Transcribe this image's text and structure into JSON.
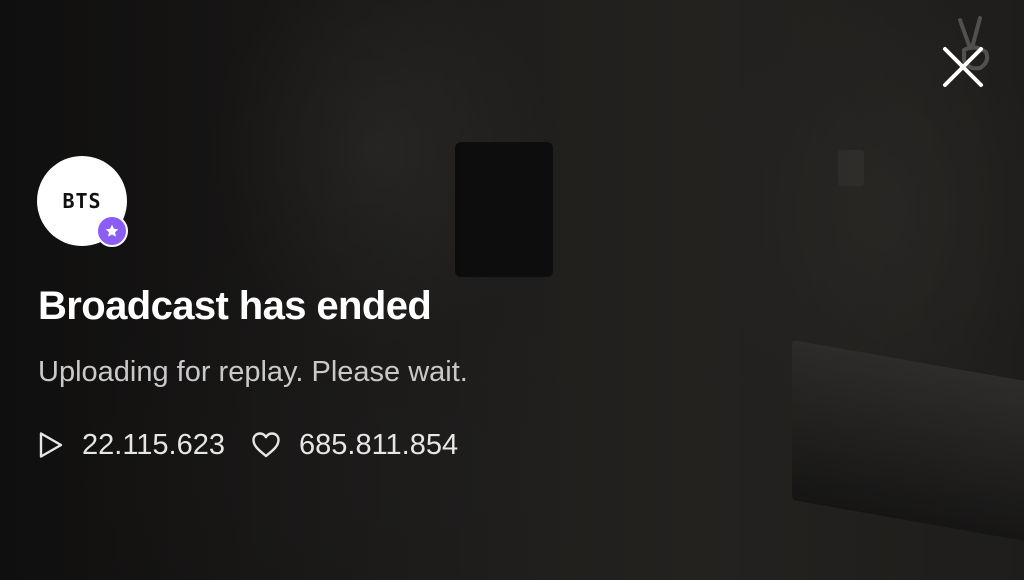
{
  "channel": {
    "avatar_text": "BTS",
    "badge_icon": "star-icon",
    "badge_color": "#8b5cf6"
  },
  "watermark_icon": "v-hand-logo",
  "close_icon": "close-icon",
  "overlay": {
    "title": "Broadcast has ended",
    "subtitle": "Uploading for replay. Please wait."
  },
  "stats": {
    "plays": "22.115.623",
    "plays_icon": "play-icon",
    "likes": "685.811.854",
    "likes_icon": "heart-icon"
  },
  "colors": {
    "text_primary": "#ffffff",
    "text_secondary": "#c9c9c9"
  }
}
